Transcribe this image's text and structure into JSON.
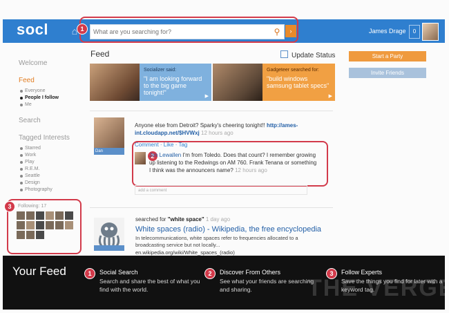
{
  "header": {
    "logo": "socl",
    "search_placeholder": "What are you searching for?",
    "user_name": "James Drage",
    "notif_count": "0"
  },
  "sidebar": {
    "welcome": "Welcome",
    "feed": "Feed",
    "feed_items": [
      "Everyone",
      "People I follow",
      "Me"
    ],
    "search": "Search",
    "tagged_interests": "Tagged Interests",
    "tag_items": [
      "Starred",
      "Work",
      "Play",
      "R.E.M.",
      "Seattle",
      "Design",
      "Photography"
    ],
    "following": "Following: 17"
  },
  "main": {
    "title": "Feed",
    "update_status": "Update Status",
    "banners": [
      {
        "by": "Socializer said:",
        "text": "\"I am looking forward to the big game tonight!\""
      },
      {
        "by": "Gadgeteer searched for:",
        "text": "\"build windows samsung tablet specs\""
      }
    ],
    "post": {
      "avatar_name": "Dan",
      "text": "Anyone else from Detroit? Sparky's cheering tonight!!",
      "link": "http://ames-int.cloudapp.net/$HVWxj",
      "time": "12 hours ago",
      "comment": "Comment",
      "like": "Like",
      "tag": "Tag",
      "reply_name": "Jim Lewallen",
      "reply_text": "I'm from Toledo. Does that count? I remember growing up listening to the Redwings on AM 760. Frank Tenana or something I think was the announcers name?",
      "reply_time": "12 hours ago",
      "add_comment": "add a comment"
    },
    "search_result": {
      "label_prefix": "searched for",
      "query": "\"white space\"",
      "time": "1 day ago",
      "title": "White spaces (radio) - Wikipedia, the free encyclopedia",
      "desc": "In telecommunications, white spaces refer to frequencies allocated to a broadcasting service but not locally...",
      "url": "en.wikipedia.org/wiki/White_spaces_(radio)"
    }
  },
  "right": {
    "party": "Start a Party",
    "invite": "Invite Friends"
  },
  "markers": [
    "1",
    "2",
    "3"
  ],
  "footer": {
    "title": "Your Feed",
    "features": [
      {
        "num": "1",
        "title": "Social Search",
        "desc": "Search and share the best of what you find with the world."
      },
      {
        "num": "2",
        "title": "Discover From Others",
        "desc": "See what your friends are searching and sharing."
      },
      {
        "num": "3",
        "title": "Follow Experts",
        "desc": "Save the things you find for later with a keyword tag."
      }
    ],
    "watermark": "THE VERGE"
  },
  "colors": {
    "header_blue": "#2f7fcf",
    "accent_orange": "#ef9a3e",
    "highlight_red": "#d23a4a"
  }
}
